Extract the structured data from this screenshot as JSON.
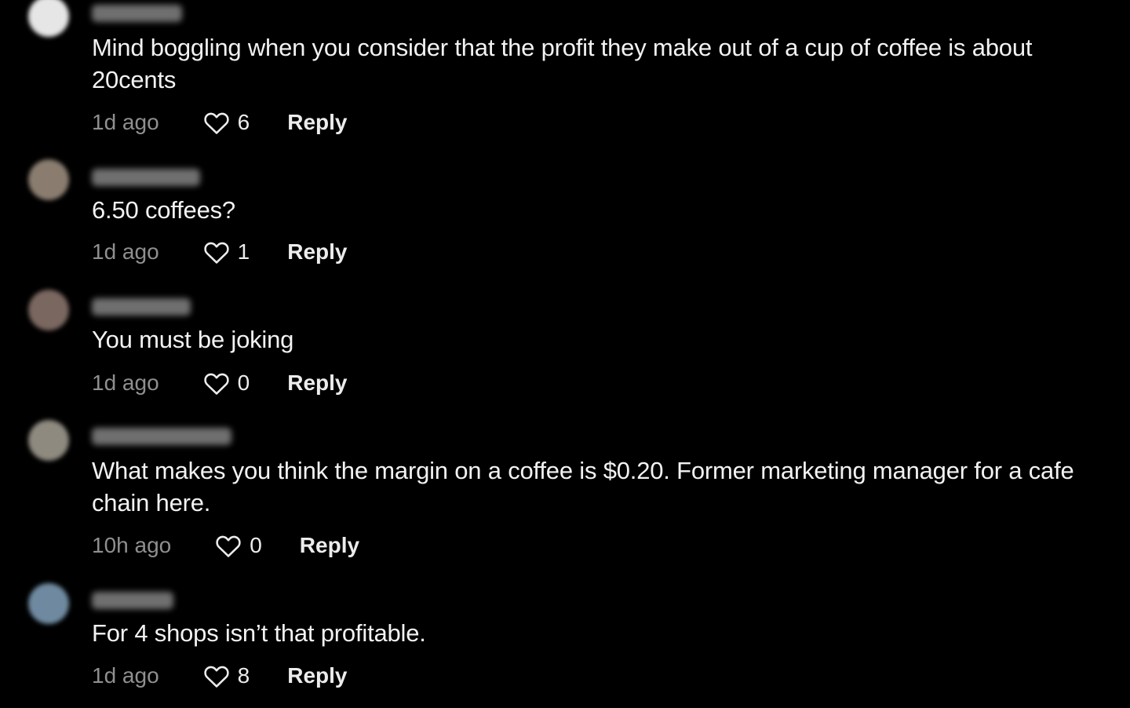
{
  "comments": [
    {
      "avatar_color": "#e6e6e6",
      "text": "Mind boggling when you consider that the profit they make out of a cup of coffee is about 20cents",
      "time": "1d ago",
      "likes": "6",
      "reply_label": "Reply"
    },
    {
      "avatar_color": "#8a7d70",
      "text": "6.50 coffees?",
      "time": "1d ago",
      "likes": "1",
      "reply_label": "Reply"
    },
    {
      "avatar_color": "#7a6760",
      "text": "You must be joking",
      "time": "1d ago",
      "likes": "0",
      "reply_label": "Reply"
    },
    {
      "avatar_color": "#8f8a80",
      "text": "What makes you think the margin on a coffee is $0.20. Former marketing manager for a cafe chain here.",
      "time": "10h ago",
      "likes": "0",
      "reply_label": "Reply"
    },
    {
      "avatar_color": "#6f8aa0",
      "text": "For 4 shops isn’t that profitable.",
      "time": "1d ago",
      "likes": "8",
      "reply_label": "Reply"
    }
  ],
  "icons": {
    "like": "heart-outline-icon"
  }
}
